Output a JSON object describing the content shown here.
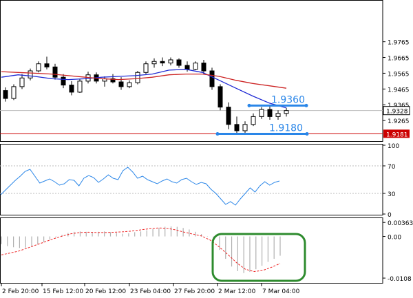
{
  "chart_data": [
    {
      "type": "candlestick",
      "panel": "price",
      "ylim": [
        1.913,
        2.003
      ],
      "y_ticks": [
        "1.9765",
        "1.9665",
        "1.9565",
        "1.9465",
        "1.9365",
        "1.9265"
      ],
      "current_price": "1.9328",
      "support_level": "1.9181",
      "annotations": [
        {
          "text": "1.9360",
          "level": 1.936,
          "color": "#2a86e8"
        },
        {
          "text": "1.9180",
          "level": 1.918,
          "color": "#2a86e8"
        }
      ],
      "candles": [
        [
          1.9455,
          1.9475,
          1.9385,
          1.9405
        ],
        [
          1.9405,
          1.9495,
          1.9395,
          1.948
        ],
        [
          1.948,
          1.956,
          1.9465,
          1.9535
        ],
        [
          1.9535,
          1.9595,
          1.952,
          1.958
        ],
        [
          1.958,
          1.964,
          1.957,
          1.9625
        ],
        [
          1.9625,
          1.967,
          1.959,
          1.9605
        ],
        [
          1.9605,
          1.9625,
          1.9525,
          1.954
        ],
        [
          1.954,
          1.956,
          1.947,
          1.949
        ],
        [
          1.949,
          1.9515,
          1.9425,
          1.9445
        ],
        [
          1.9445,
          1.953,
          1.944,
          1.9515
        ],
        [
          1.9515,
          1.9575,
          1.95,
          1.9555
        ],
        [
          1.9555,
          1.957,
          1.95,
          1.9515
        ],
        [
          1.9515,
          1.9545,
          1.948,
          1.953
        ],
        [
          1.953,
          1.956,
          1.95,
          1.951
        ],
        [
          1.951,
          1.954,
          1.946,
          1.948
        ],
        [
          1.948,
          1.952,
          1.947,
          1.9505
        ],
        [
          1.9505,
          1.958,
          1.9495,
          1.957
        ],
        [
          1.957,
          1.964,
          1.956,
          1.9625
        ],
        [
          1.9625,
          1.966,
          1.96,
          1.964
        ],
        [
          1.964,
          1.9665,
          1.961,
          1.963
        ],
        [
          1.963,
          1.9665,
          1.9615,
          1.965
        ],
        [
          1.965,
          1.966,
          1.96,
          1.9615
        ],
        [
          1.9615,
          1.964,
          1.9575,
          1.959
        ],
        [
          1.959,
          1.964,
          1.9585,
          1.963
        ],
        [
          1.963,
          1.965,
          1.956,
          1.958
        ],
        [
          1.958,
          1.96,
          1.946,
          1.948
        ],
        [
          1.948,
          1.9495,
          1.933,
          1.935
        ],
        [
          1.935,
          1.938,
          1.921,
          1.924
        ],
        [
          1.924,
          1.929,
          1.918,
          1.92
        ],
        [
          1.92,
          1.926,
          1.918,
          1.924
        ],
        [
          1.924,
          1.931,
          1.923,
          1.929
        ],
        [
          1.929,
          1.935,
          1.9275,
          1.9335
        ],
        [
          1.9335,
          1.9365,
          1.927,
          1.929
        ],
        [
          1.929,
          1.933,
          1.927,
          1.931
        ],
        [
          1.931,
          1.9345,
          1.929,
          1.9328
        ]
      ],
      "ma_blue": [
        1.954,
        1.9555,
        1.9545,
        1.953,
        1.9525,
        1.953,
        1.954,
        1.9545,
        1.955,
        1.956,
        1.9585,
        1.959,
        1.957,
        1.952,
        1.947,
        1.942,
        1.9375,
        1.9345
      ],
      "ma_red": [
        1.9575,
        1.957,
        1.9565,
        1.956,
        1.955,
        1.954,
        1.953,
        1.9525,
        1.953,
        1.954,
        1.9555,
        1.956,
        1.956,
        1.9545,
        1.952,
        1.95,
        1.9485,
        1.947
      ]
    },
    {
      "type": "line",
      "panel": "oscillator",
      "ylim": [
        0,
        100
      ],
      "y_ticks": [
        "100",
        "70",
        "30",
        "0"
      ],
      "values": [
        28,
        35,
        42,
        49,
        55,
        62,
        65,
        55,
        45,
        48,
        51,
        47,
        42,
        44,
        50,
        49,
        41,
        52,
        56,
        53,
        46,
        51,
        57,
        52,
        50,
        63,
        68,
        61,
        52,
        55,
        50,
        47,
        44,
        48,
        51,
        47,
        45,
        50,
        52,
        47,
        43,
        46,
        44,
        36,
        30,
        22,
        14,
        18,
        13,
        22,
        30,
        38,
        32,
        41,
        47,
        42,
        46,
        48
      ]
    },
    {
      "type": "bar",
      "panel": "macd",
      "ylim": [
        -0.0115,
        0.0042
      ],
      "y_ticks": [
        "0.00363",
        "0.00",
        "-0.0108"
      ],
      "histogram": [
        -0.002,
        -0.0025,
        -0.0028,
        -0.003,
        -0.0029,
        -0.0026,
        -0.0021,
        -0.0015,
        -0.0008,
        -0.0002,
        0.0004,
        0.0009,
        0.0012,
        0.0013,
        0.0012,
        0.0011,
        0.0012,
        0.0013,
        0.0011,
        0.0009,
        0.0007,
        0.0008,
        0.0011,
        0.0013,
        0.0016,
        0.0019,
        0.0022,
        0.0025,
        0.0026,
        0.0025,
        0.0022,
        0.0018,
        0.0012,
        0.0006,
        -0.0001,
        -0.0014,
        -0.0035,
        -0.0058,
        -0.0078,
        -0.009,
        -0.0095,
        -0.0092,
        -0.0085,
        -0.0076,
        -0.0066,
        -0.0058,
        -0.005
      ],
      "signal": [
        -0.0048,
        -0.0043,
        -0.0038,
        -0.003,
        -0.0022,
        -0.0014,
        -0.0006,
        0.0001,
        0.0007,
        0.001,
        0.0011,
        0.001,
        0.001,
        0.0011,
        0.0012,
        0.0014,
        0.0017,
        0.002,
        0.0022,
        0.0021,
        0.0017,
        0.0011,
        0.0006,
        0.0001,
        -0.001,
        -0.0027,
        -0.0047,
        -0.0068,
        -0.0085,
        -0.0091,
        -0.0088,
        -0.008,
        -0.007
      ]
    }
  ],
  "x_labels": [
    "2 Feb 20:00",
    "15 Feb 12:00",
    "20 Feb 12:00",
    "23 Feb 04:00",
    "27 Feb 20:00",
    "2 Mar 12:00",
    "7 Mar 04:00"
  ],
  "colors": {
    "bull": "#ffffff",
    "bear": "#000000",
    "ma_blue": "#1f2ad4",
    "ma_red": "#cc2222",
    "hline": "#2a86e8",
    "support": "#cc0000",
    "osc": "#2a86e8",
    "hist": "#b0b0b0",
    "signal": "#ee2222",
    "highlight": "#2e8b2e"
  }
}
